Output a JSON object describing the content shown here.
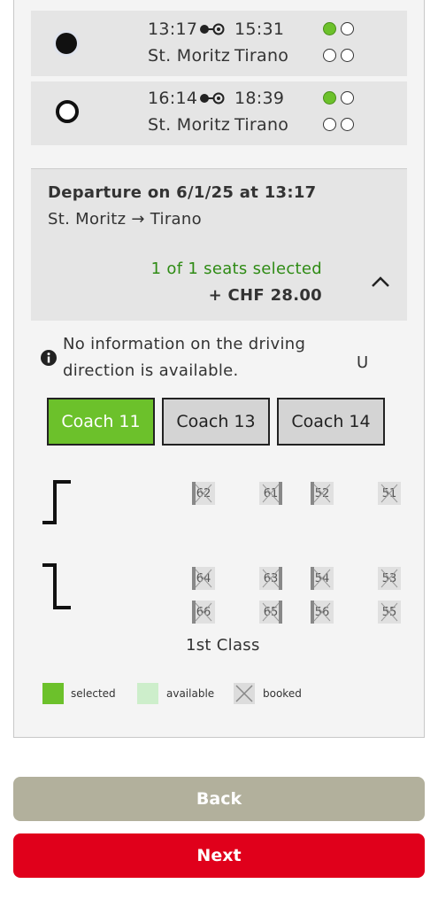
{
  "connections": [
    {
      "selected": true,
      "dep_time": "13:17",
      "arr_time": "15:31",
      "from": "St. Moritz",
      "to": "Tirano",
      "occupancy_top": [
        "green",
        "empty"
      ],
      "occupancy_bottom": [
        "empty",
        "empty"
      ]
    },
    {
      "selected": false,
      "dep_time": "16:14",
      "arr_time": "18:39",
      "from": "St. Moritz",
      "to": "Tirano",
      "occupancy_top": [
        "green",
        "empty"
      ],
      "occupancy_bottom": [
        "empty",
        "empty"
      ]
    }
  ],
  "summary": {
    "departure": "Departure on 6/1/25 at 13:17",
    "route": "St. Moritz → Tirano",
    "seats_selected": "1 of 1 seats selected",
    "price": "+ CHF 28.00",
    "collapse_icon": "chevron-up-icon"
  },
  "info": {
    "icon": "info-icon",
    "text_line1": "No information on the driving",
    "text_line2": "direction is available.",
    "side_letter": "U"
  },
  "coaches": [
    {
      "label": "Coach 11",
      "selected": true
    },
    {
      "label": "Coach 13",
      "selected": false
    },
    {
      "label": "Coach 14",
      "selected": false
    }
  ],
  "seats": {
    "row1": [
      "62",
      "61",
      "52",
      "51"
    ],
    "row2": [
      "64",
      "63",
      "54",
      "53"
    ],
    "row3": [
      "66",
      "65",
      "56",
      "55"
    ],
    "class_label": "1st Class"
  },
  "legend": {
    "selected": "selected",
    "available": "available",
    "booked": "booked",
    "colors": {
      "selected": "#6cc12b",
      "available": "#cdeecb",
      "booked": "#dcdcdc"
    }
  },
  "buttons": {
    "back": "Back",
    "next": "Next",
    "back_color": "#b2b09c",
    "next_color": "#e0001b"
  }
}
